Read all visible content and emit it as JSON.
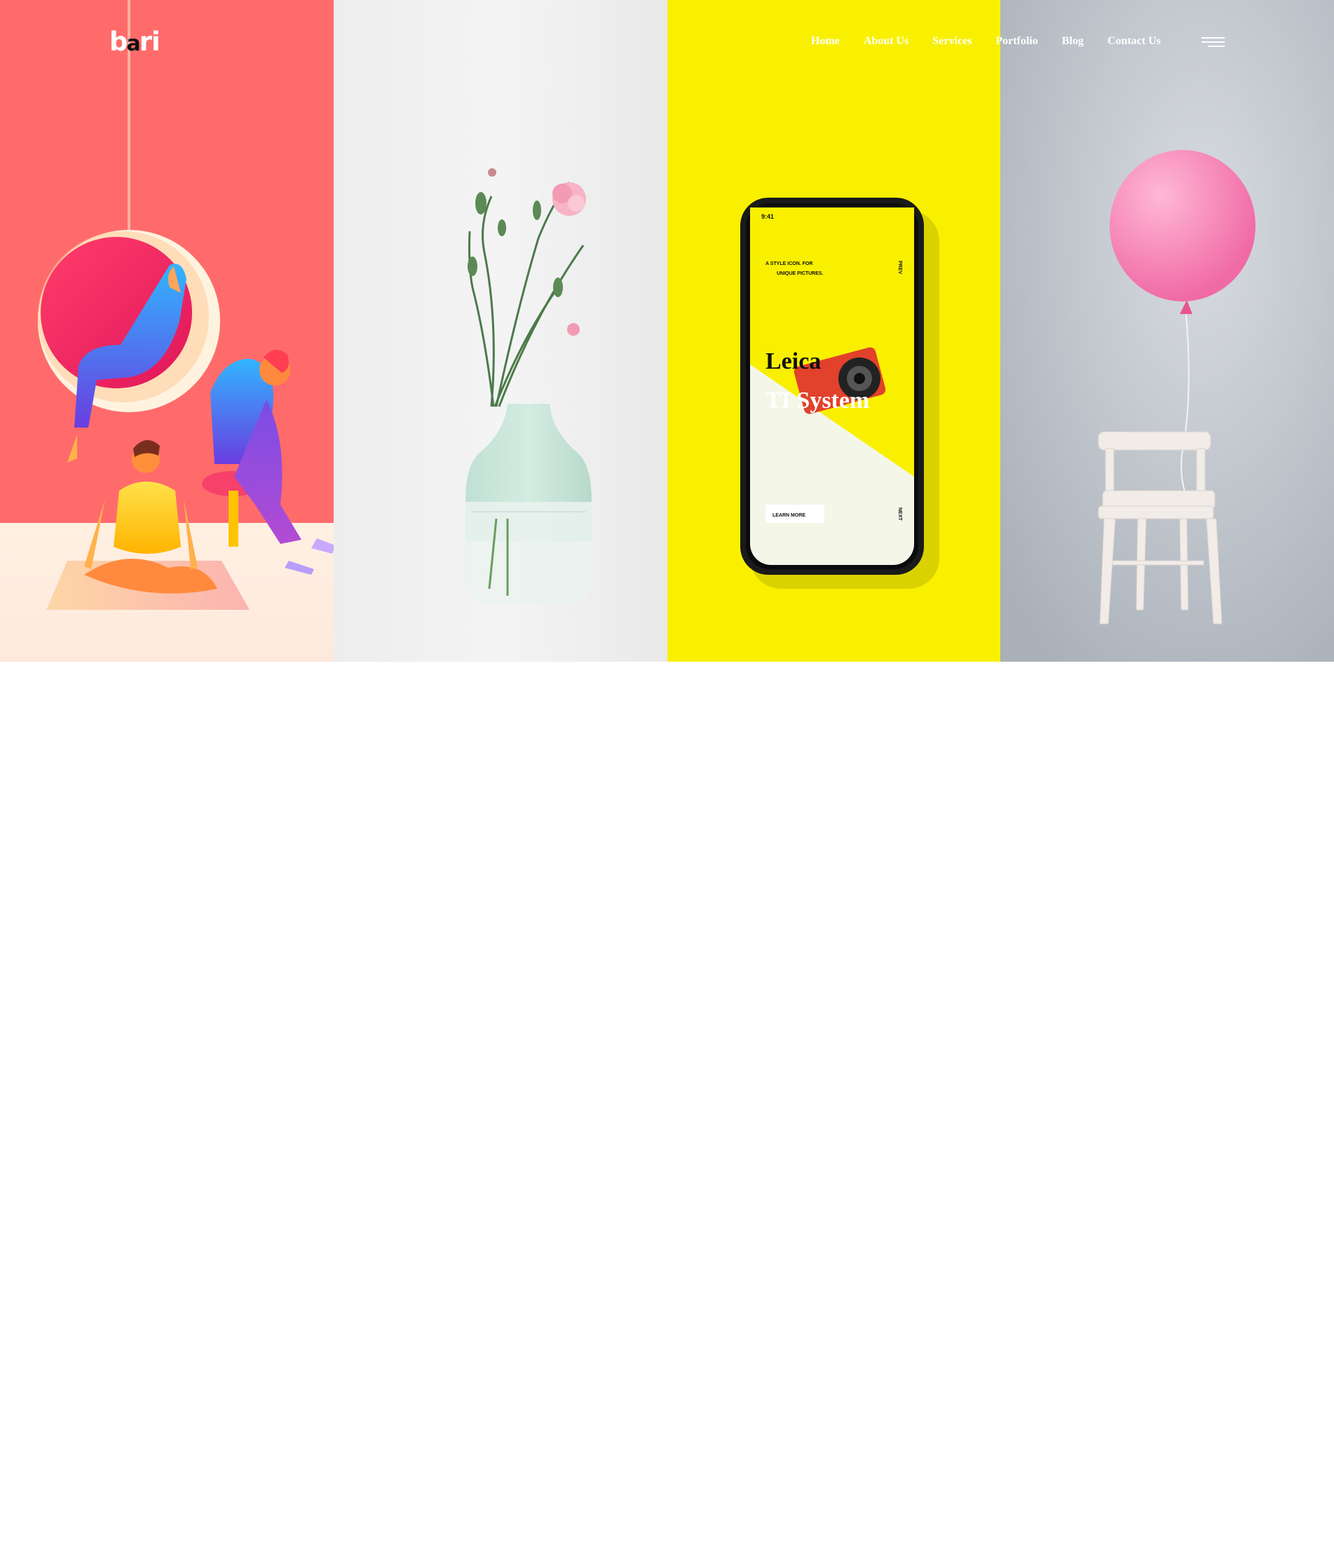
{
  "brand": {
    "logo_text_b": "b",
    "logo_text_a": "a",
    "logo_text_ri": "ri"
  },
  "nav": {
    "items": [
      {
        "label": "Home"
      },
      {
        "label": "About Us"
      },
      {
        "label": "Services"
      },
      {
        "label": "Portfolio"
      },
      {
        "label": "Blog"
      },
      {
        "label": "Contact Us"
      }
    ]
  },
  "hero": {
    "panels": [
      {
        "name": "illustration-people",
        "background": "#ff6b6b"
      },
      {
        "name": "flower-vase",
        "background": "#eeeeee"
      },
      {
        "name": "phone-mockup",
        "background": "#f9f000"
      },
      {
        "name": "balloon-chair",
        "background": "#b9bfc6"
      }
    ],
    "phone_screen": {
      "time": "9:41",
      "tagline_line1": "A STYLE ICON. FOR",
      "tagline_line2": "UNIQUE PICTURES.",
      "side_top": "PREV",
      "title_line1": "Leica",
      "title_line2": "TI System",
      "button": "LEARN MORE",
      "side_bottom": "NEXT"
    }
  },
  "colors": {
    "nav_text": "#ffffff",
    "page_background": "#ffffff"
  }
}
